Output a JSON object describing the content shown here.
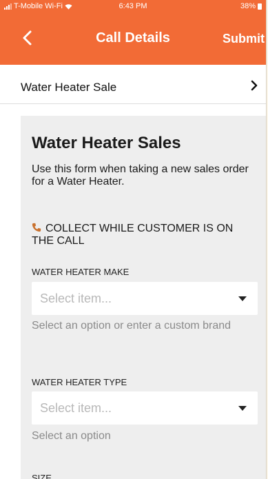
{
  "status_bar": {
    "carrier": "T-Mobile Wi-Fi",
    "time": "6:43 PM",
    "battery": "38%"
  },
  "nav": {
    "title": "Call Details",
    "submit_label": "Submit"
  },
  "selected_form": {
    "label": "Water Heater Sale"
  },
  "form": {
    "title": "Water Heater Sales",
    "description": "Use this form when taking a new sales order for a Water Heater.",
    "section_heading": "COLLECT WHILE CUSTOMER IS ON THE CALL",
    "fields": [
      {
        "label": "WATER HEATER MAKE",
        "placeholder": "Select item...",
        "hint": "Select an option or enter a custom brand"
      },
      {
        "label": "WATER HEATER TYPE",
        "placeholder": "Select item...",
        "hint": "Select an option"
      },
      {
        "label": "SIZE"
      }
    ]
  },
  "colors": {
    "brand": "#f26b36",
    "card_background": "#eeeeee",
    "page_background": "#fbf6ea"
  }
}
